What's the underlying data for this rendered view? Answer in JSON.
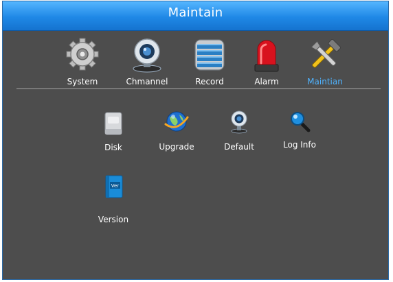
{
  "window": {
    "title": "Maintain"
  },
  "top_menu": [
    {
      "label": "System",
      "icon": "gear-icon"
    },
    {
      "label": "Chmannel",
      "icon": "camera-icon"
    },
    {
      "label": "Record",
      "icon": "hard-drive-icon"
    },
    {
      "label": "Alarm",
      "icon": "siren-icon"
    },
    {
      "label": "Maintian",
      "icon": "tools-icon",
      "active": true
    }
  ],
  "sub_menu": [
    {
      "label": "Disk",
      "icon": "disk-icon"
    },
    {
      "label": "Upgrade",
      "icon": "globe-icon"
    },
    {
      "label": "Default",
      "icon": "webcam-icon"
    },
    {
      "label": "Log Info",
      "icon": "magnifier-icon"
    },
    {
      "label": "Version",
      "icon": "version-book-icon",
      "badge": "Ver"
    }
  ],
  "colors": {
    "title_bar": "#1f88e6",
    "background": "#4d4d4d",
    "active_label": "#4fb3ff"
  }
}
